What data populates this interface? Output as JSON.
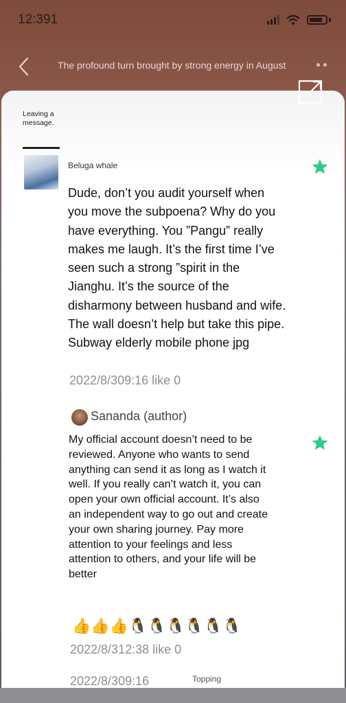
{
  "status_bar": {
    "time": "12:391"
  },
  "nav": {
    "title": "The profound turn brought by strong energy in August",
    "back_icon": "chevron-left-icon",
    "more_icon": "more-dots-icon",
    "share_icon": "external-link-icon"
  },
  "tab": {
    "label": "Leaving a message."
  },
  "comments": [
    {
      "author": "Beluga whale",
      "text": "Dude, don’t you audit yourself when you move the subpoena? Why do you have everything. You ”Pangu” really makes me laugh. It’s the first time I’ve seen such a strong ”spirit in the Jianghu. It’s the source of the disharmony between husband and wife. The wall doesn’t help but take this pipe. Subway elderly mobile phone jpg",
      "meta": "2022/8/309:16 like 0"
    },
    {
      "author": "Sananda (author)",
      "text": "My official account doesn’t need to be reviewed. Anyone who wants to send anything can send it as long as I watch it well. If you really can’t watch it, you can open your own official account. It’s also an independent way to go out and create your own sharing journey. Pay more attention to your feelings and less attention to others, and your life will be better",
      "emojis": "👍👍👍🐧🐧🐧🐧🐧🐧",
      "meta": "2022/8/312:38 like 0"
    }
  ],
  "footer": {
    "timestamp": "2022/8/309:16",
    "topping_label": "Topping"
  },
  "colors": {
    "star": "#2fcb8a",
    "header_gradient_top": "#7e4a3a",
    "meta_text": "#8e8e8e"
  }
}
